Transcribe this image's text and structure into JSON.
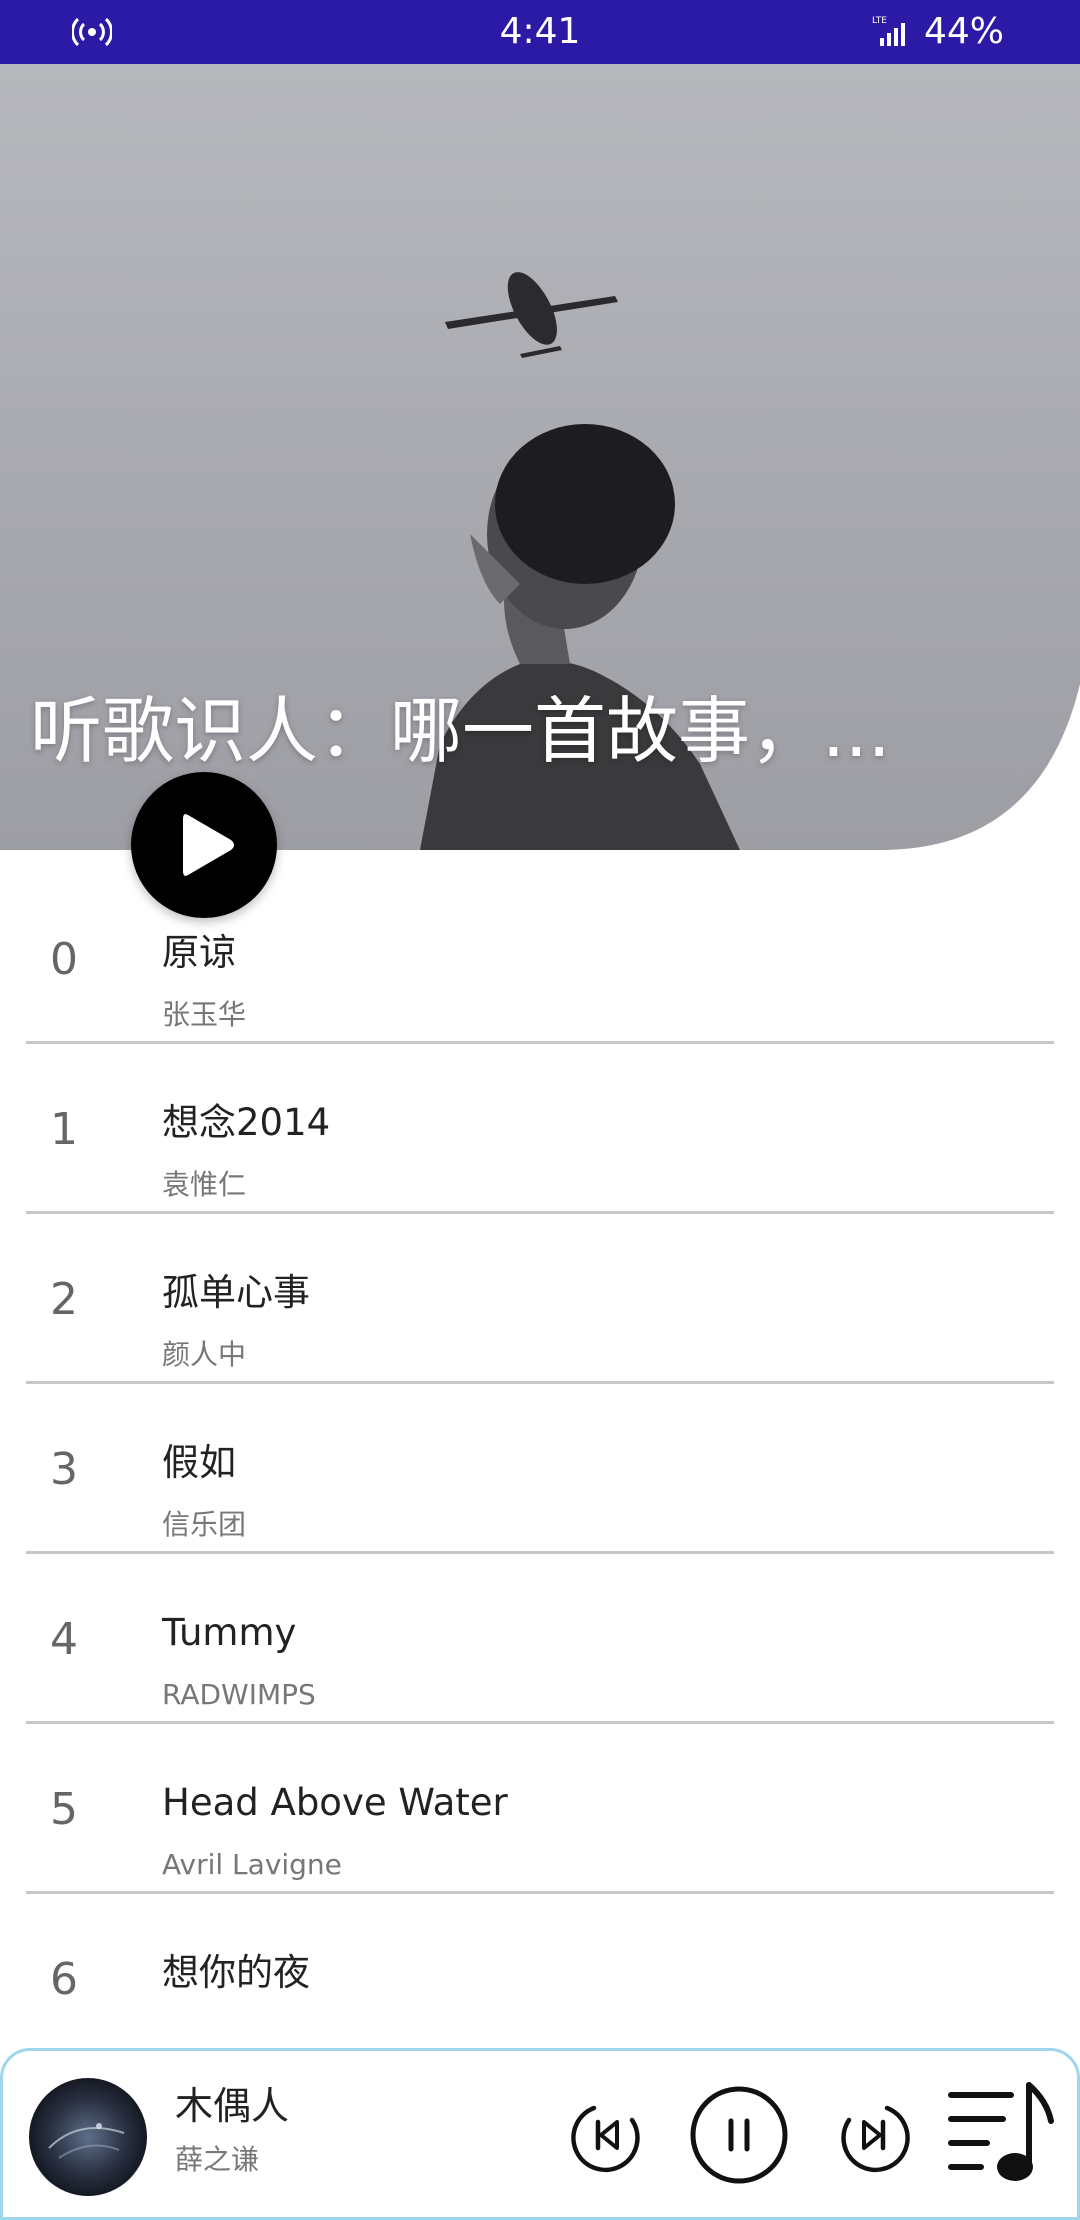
{
  "status_bar": {
    "time": "4:41",
    "battery": "44%",
    "icons": [
      "hotspot-icon",
      "lte-signal-icon"
    ]
  },
  "hero": {
    "title": "听歌识人：哪一首故事，...",
    "play_icon": "play-icon"
  },
  "songs": [
    {
      "index": "0",
      "title": "原谅",
      "artist": "张玉华"
    },
    {
      "index": "1",
      "title": "想念2014",
      "artist": "袁惟仁"
    },
    {
      "index": "2",
      "title": "孤单心事",
      "artist": "颜人中"
    },
    {
      "index": "3",
      "title": "假如",
      "artist": "信乐团"
    },
    {
      "index": "4",
      "title": "Tummy",
      "artist": "RADWIMPS"
    },
    {
      "index": "5",
      "title": "Head Above Water",
      "artist": "Avril Lavigne"
    },
    {
      "index": "6",
      "title": "想你的夜",
      "artist": ""
    }
  ],
  "now_playing": {
    "title": "木偶人",
    "artist": "薛之谦",
    "icons": [
      "previous-icon",
      "pause-icon",
      "next-icon",
      "playlist-icon"
    ]
  },
  "colors": {
    "status_bar": "#2a1aa6",
    "player_border": "#9fd6ec"
  }
}
